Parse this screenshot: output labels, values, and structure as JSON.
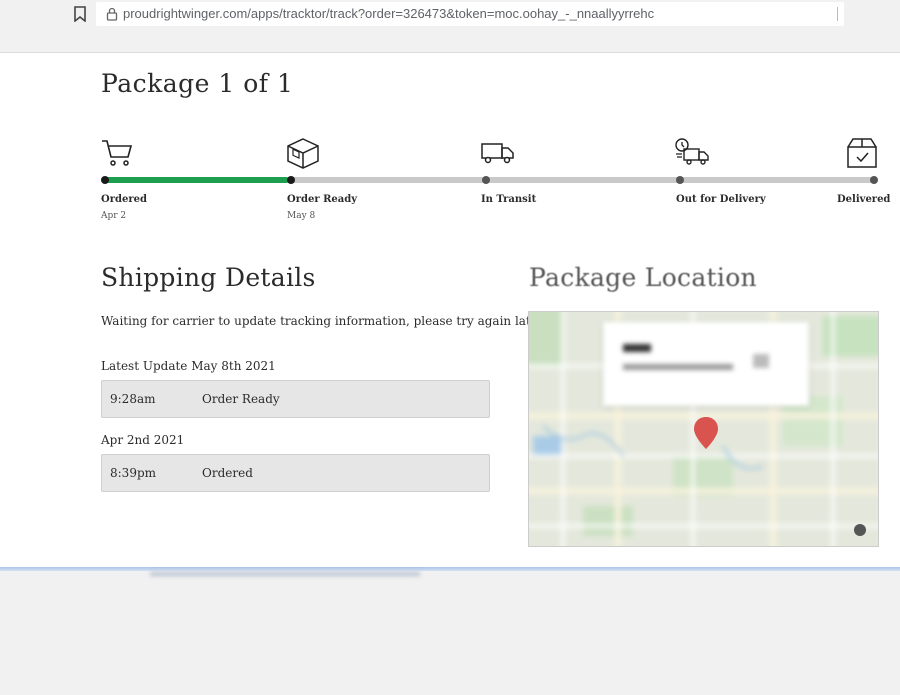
{
  "browser": {
    "url": "proudrightwinger.com/apps/tracktor/track?order=326473&token=moc.oohay_-_nnaallyyrrehc"
  },
  "page": {
    "title": "Package 1 of 1"
  },
  "tracker": {
    "progress_fraction": 0.24,
    "steps": [
      {
        "label": "Ordered",
        "date": "Apr 2",
        "icon": "cart-icon",
        "done": true
      },
      {
        "label": "Order Ready",
        "date": "May 8",
        "icon": "box-icon",
        "done": true
      },
      {
        "label": "In Transit",
        "date": "",
        "icon": "truck-icon",
        "done": false
      },
      {
        "label": "Out for Delivery",
        "date": "",
        "icon": "delivery-truck-clock-icon",
        "done": false
      },
      {
        "label": "Delivered",
        "date": "",
        "icon": "box-check-icon",
        "done": false
      }
    ],
    "colors": {
      "done": "#1e9e4f",
      "pending": "#c9c9c9"
    }
  },
  "shipping": {
    "title": "Shipping Details",
    "status_message": "Waiting for carrier to update tracking information, please try again later.",
    "groups": [
      {
        "heading": "Latest Update May 8th 2021",
        "events": [
          {
            "time": "9:28am",
            "status": "Order Ready"
          }
        ]
      },
      {
        "heading": "Apr 2nd 2021",
        "events": [
          {
            "time": "8:39pm",
            "status": "Ordered"
          }
        ]
      }
    ]
  },
  "location": {
    "title": "Package Location",
    "pin_color": "#d9534f"
  }
}
